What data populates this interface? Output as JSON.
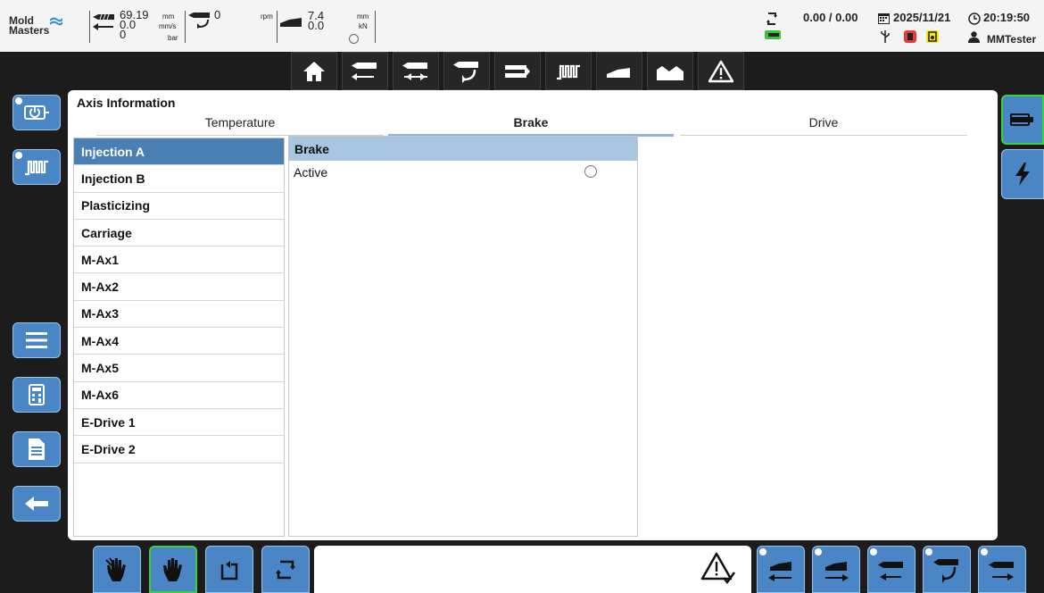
{
  "header": {
    "logo_line1": "Mold",
    "logo_line2": "Masters",
    "position_value": "69.19",
    "speed_value": "0.0",
    "pressure_value": "0",
    "pos_unit": "mm",
    "speed_unit": "mm/s",
    "pressure_unit": "bar",
    "screw_value": "0",
    "rpm_unit": "rpm",
    "carriage_pos": "7.4",
    "carriage_force": "0.0",
    "carriage_pos_unit": "mm",
    "carriage_force_unit": "kN",
    "cycle_times": "0.00 / 0.00",
    "date": "2025/11/21",
    "time": "20:19:50",
    "user": "MMTester"
  },
  "top_toolbar": [
    "home-icon",
    "injection-icon",
    "hold-icon",
    "screw-icon",
    "mold-icon",
    "heater-icon",
    "carriage-icon",
    "profile-icon",
    "warning-icon"
  ],
  "left_buttons": [
    "power-icon",
    "heater-icon",
    "menu-icon",
    "calculator-icon",
    "document-icon",
    "back-icon"
  ],
  "right_buttons": [
    "axis-info-icon",
    "lightning-icon"
  ],
  "panel": {
    "title": "Axis Information",
    "tabs": [
      {
        "label": "Temperature",
        "active": false
      },
      {
        "label": "Brake",
        "active": true
      },
      {
        "label": "Drive",
        "active": false
      }
    ],
    "axes": [
      "Injection A",
      "Injection B",
      "Plasticizing",
      "Carriage",
      "M-Ax1",
      "M-Ax2",
      "M-Ax3",
      "M-Ax4",
      "M-Ax5",
      "M-Ax6",
      "E-Drive 1",
      "E-Drive 2"
    ],
    "selected_axis": "Injection A",
    "brake": {
      "header": "Brake",
      "row_label": "Active",
      "active": false
    }
  },
  "bottom_buttons": [
    "manual-hands-icon",
    "manual-hand-icon",
    "semi-auto-icon",
    "auto-cycle-icon",
    "carriage-back-icon",
    "carriage-forward-icon",
    "inject-back-icon",
    "screw-rotate-icon",
    "inject-forward-icon"
  ],
  "colors": {
    "button_blue": "#4a86c5",
    "selected_row": "#4a7fb3",
    "brake_header": "#a8c6e2",
    "active_outline": "#39d239"
  }
}
